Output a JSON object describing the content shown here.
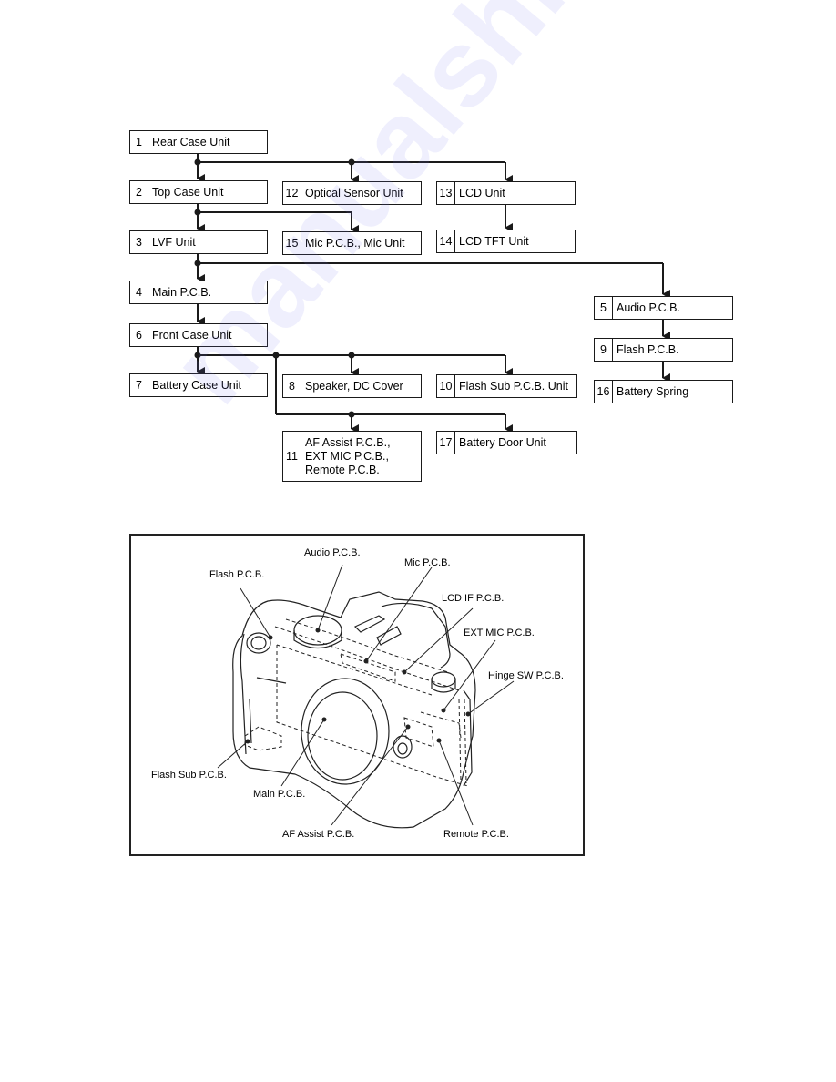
{
  "flowchart": {
    "boxes": [
      {
        "num": "1",
        "label": "Rear Case Unit"
      },
      {
        "num": "2",
        "label": "Top Case Unit"
      },
      {
        "num": "12",
        "label": "Optical Sensor Unit"
      },
      {
        "num": "13",
        "label": "LCD Unit"
      },
      {
        "num": "14",
        "label": "LCD TFT Unit"
      },
      {
        "num": "3",
        "label": "LVF Unit"
      },
      {
        "num": "15",
        "label": "Mic P.C.B., Mic Unit"
      },
      {
        "num": "4",
        "label": "Main P.C.B."
      },
      {
        "num": "5",
        "label": "Audio P.C.B."
      },
      {
        "num": "6",
        "label": "Front Case Unit"
      },
      {
        "num": "9",
        "label": "Flash P.C.B."
      },
      {
        "num": "7",
        "label": "Battery Case Unit"
      },
      {
        "num": "8",
        "label": "Speaker, DC Cover"
      },
      {
        "num": "10",
        "label": "Flash Sub P.C.B. Unit"
      },
      {
        "num": "16",
        "label": "Battery Spring"
      },
      {
        "num": "11",
        "label": "AF Assist P.C.B.,\nEXT MIC P.C.B.,\nRemote P.C.B."
      },
      {
        "num": "17",
        "label": "Battery Door Unit"
      }
    ],
    "edges": [
      [
        "1",
        "2"
      ],
      [
        "1",
        "12"
      ],
      [
        "1",
        "13"
      ],
      [
        "13",
        "14"
      ],
      [
        "2",
        "3"
      ],
      [
        "2",
        "15"
      ],
      [
        "3",
        "4"
      ],
      [
        "3",
        "5"
      ],
      [
        "5",
        "9"
      ],
      [
        "9",
        "16"
      ],
      [
        "4",
        "6"
      ],
      [
        "6",
        "7"
      ],
      [
        "6",
        "8"
      ],
      [
        "6",
        "10"
      ],
      [
        "6",
        "11"
      ],
      [
        "6",
        "17"
      ]
    ]
  },
  "pcb_figure": {
    "callouts": {
      "audio": "Audio P.C.B.",
      "mic": "Mic P.C.B.",
      "flash": "Flash P.C.B.",
      "lcd_if": "LCD IF P.C.B.",
      "ext_mic": "EXT MIC P.C.B.",
      "hinge_sw": "Hinge SW P.C.B.",
      "flash_sub": "Flash Sub P.C.B.",
      "main": "Main P.C.B.",
      "af_assist": "AF Assist P.C.B.",
      "remote": "Remote P.C.B."
    }
  },
  "watermark": "manualshive.com",
  "colors": {
    "line": "#1a1a1a",
    "watermark": "#7878f0"
  }
}
